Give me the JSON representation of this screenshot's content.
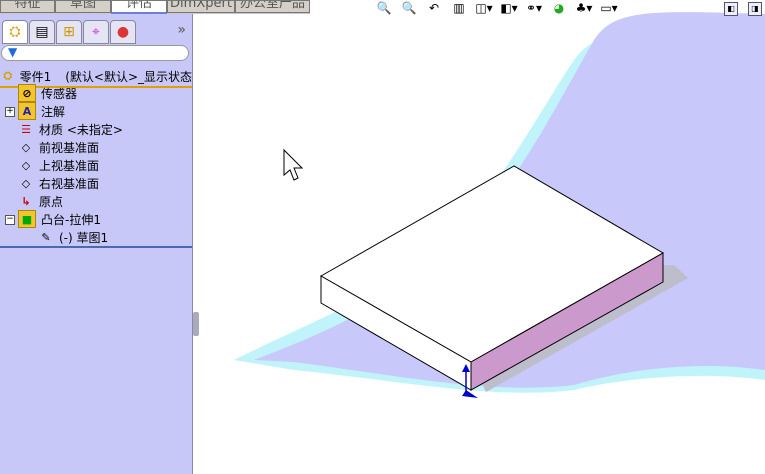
{
  "command_tabs": [
    {
      "label": "特征"
    },
    {
      "label": "草图"
    },
    {
      "label": "评估",
      "active": true
    },
    {
      "label": "DimXpert"
    },
    {
      "label": "办公室产品"
    }
  ],
  "panel_tabs": [
    "feature-manager",
    "property-manager",
    "configuration-manager",
    "dimxpert-manager",
    "display-manager"
  ],
  "root": {
    "name": "零件1",
    "config": "(默认<默认>_显示状态"
  },
  "tree": [
    {
      "label": "传感器",
      "icon": "sensor-folder-icon"
    },
    {
      "label": "注解",
      "icon": "annotation-folder-icon",
      "expander": "+"
    },
    {
      "label": "材质 <未指定>",
      "icon": "material-icon"
    },
    {
      "label": "前视基准面",
      "icon": "plane-icon"
    },
    {
      "label": "上视基准面",
      "icon": "plane-icon"
    },
    {
      "label": "右视基准面",
      "icon": "plane-icon"
    },
    {
      "label": "原点",
      "icon": "origin-icon"
    },
    {
      "label": "凸台-拉伸1",
      "icon": "extrude-icon",
      "expander": "−"
    },
    {
      "label": "(-) 草图1",
      "icon": "sketch-icon"
    }
  ],
  "colors": {
    "panel": "#c8c8f8",
    "accent": "#e0a000",
    "side_face": "#cc99cc",
    "background_blob": "#c8c8fa"
  }
}
